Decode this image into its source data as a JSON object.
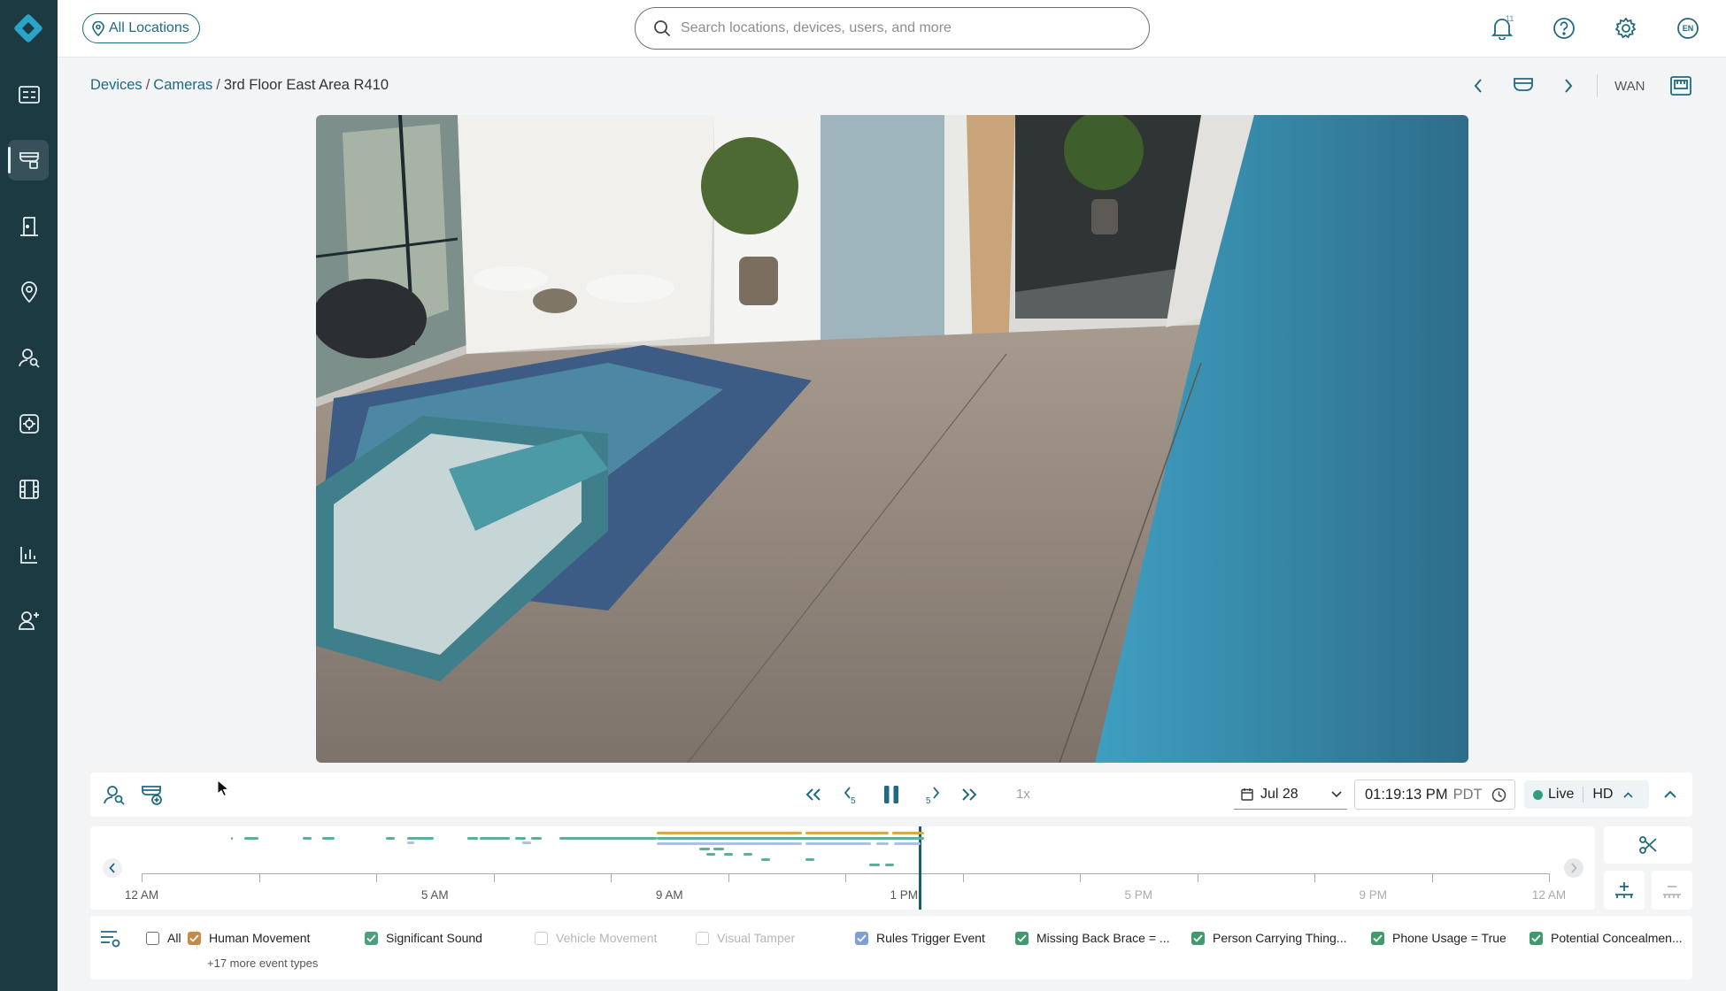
{
  "topbar": {
    "location_label": "All Locations",
    "search_placeholder": "Search locations, devices, users, and more",
    "notification_count": "11",
    "language": "EN"
  },
  "breadcrumb": {
    "devices": "Devices",
    "cameras": "Cameras",
    "current": "3rd Floor East Area R410",
    "separator": "/"
  },
  "camera_header": {
    "network": "WAN"
  },
  "controls": {
    "speed": "1x",
    "date": "Jul 28",
    "time": "01:19:13 PM",
    "timezone": "PDT",
    "live_label": "Live",
    "quality": "HD"
  },
  "timeline": {
    "labels": [
      "12 AM",
      "5 AM",
      "9 AM",
      "1 PM",
      "5 PM",
      "9 PM",
      "12 AM"
    ],
    "colors": {
      "human_movement": "#5fae9d",
      "significant_sound": "#d4a94e",
      "rules_trigger": "#a9c2e6",
      "playhead": "#1d5b6d"
    }
  },
  "filters": {
    "all": "All",
    "items": [
      {
        "label": "Human Movement",
        "checked": true,
        "color": "#c48a46"
      },
      {
        "label": "Significant Sound",
        "checked": true,
        "color": "#4aa07a"
      },
      {
        "label": "Vehicle Movement",
        "checked": false
      },
      {
        "label": "Visual Tamper",
        "checked": false
      },
      {
        "label": "Rules Trigger Event",
        "checked": true,
        "color": "#7f9fdb"
      },
      {
        "label": "Missing Back Brace = ...",
        "checked": true,
        "color": "#3f9a6e"
      },
      {
        "label": "Person Carrying Thing...",
        "checked": true,
        "color": "#3f9a6e"
      },
      {
        "label": "Phone Usage = True",
        "checked": true,
        "color": "#3f9a6e"
      },
      {
        "label": "Potential Concealmen...",
        "checked": true,
        "color": "#3f9a6e"
      }
    ],
    "more": "+17 more event types"
  },
  "accent": "#1f6a80",
  "rail_bg": "#1b3a42"
}
